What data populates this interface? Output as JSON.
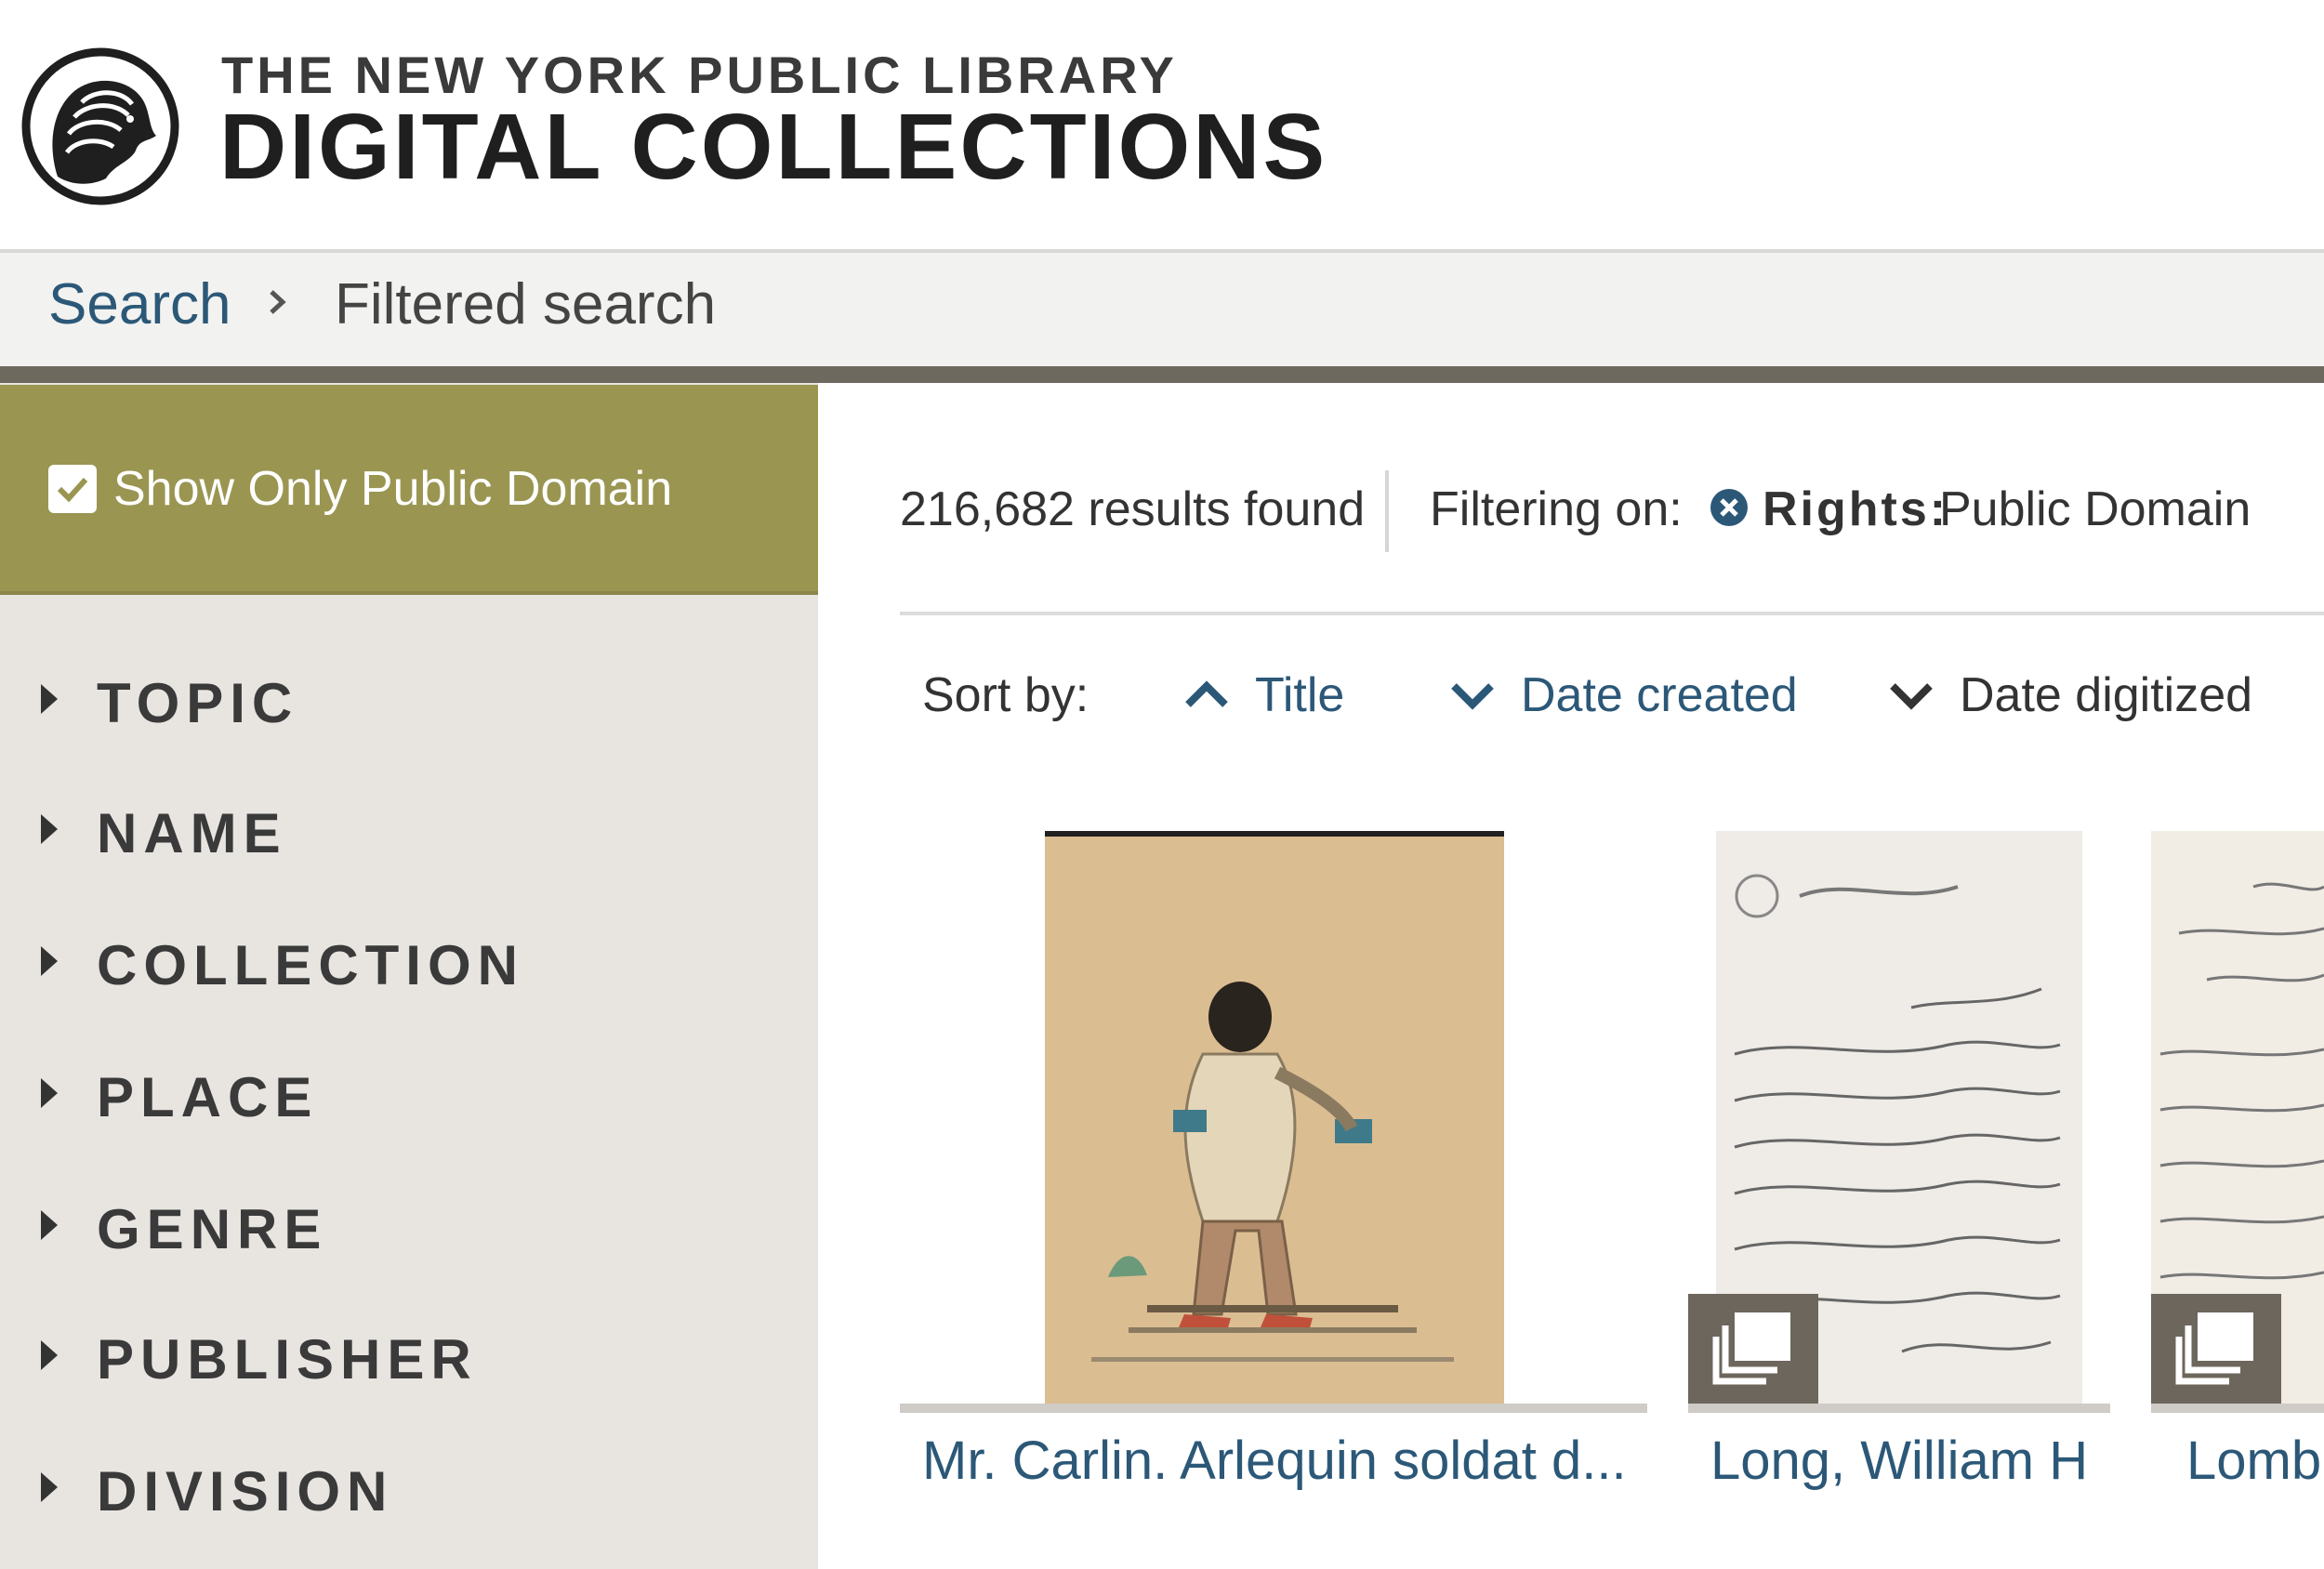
{
  "header": {
    "org_name": "THE NEW YORK PUBLIC LIBRARY",
    "site_name": "DIGITAL COLLECTIONS",
    "logo_icon": "lion-logo-icon"
  },
  "breadcrumb": {
    "link": "Search",
    "separator_icon": "chevron-right-icon",
    "current": "Filtered search"
  },
  "sidebar": {
    "public_domain_label": "Show Only Public Domain",
    "public_domain_checked": true,
    "facets": [
      "TOPIC",
      "NAME",
      "COLLECTION",
      "PLACE",
      "GENRE",
      "PUBLISHER",
      "DIVISION"
    ]
  },
  "results": {
    "count_text": "216,682 results found",
    "filter_label": "Filtering on:",
    "filter_key": "Rights:",
    "filter_value": "Public Domain",
    "remove_icon": "close-circle-icon"
  },
  "sort": {
    "label": "Sort by:",
    "options": [
      {
        "label": "Title",
        "icon": "chevron-up-icon"
      },
      {
        "label": "Date created",
        "icon": "chevron-down-icon"
      },
      {
        "label": "Date digitized",
        "icon": "chevron-down-icon"
      }
    ]
  },
  "items": [
    {
      "title": "Mr. Carlin. Arlequin soldat d...",
      "multi_image": false
    },
    {
      "title": "Long, William H",
      "multi_image": true
    },
    {
      "title": "Lomb",
      "multi_image": true
    }
  ],
  "colors": {
    "accent_olive": "#9a9652",
    "link_blue": "#2c5878",
    "sidebar_bg": "#e8e5e1",
    "rule_brown": "#6e695e"
  }
}
